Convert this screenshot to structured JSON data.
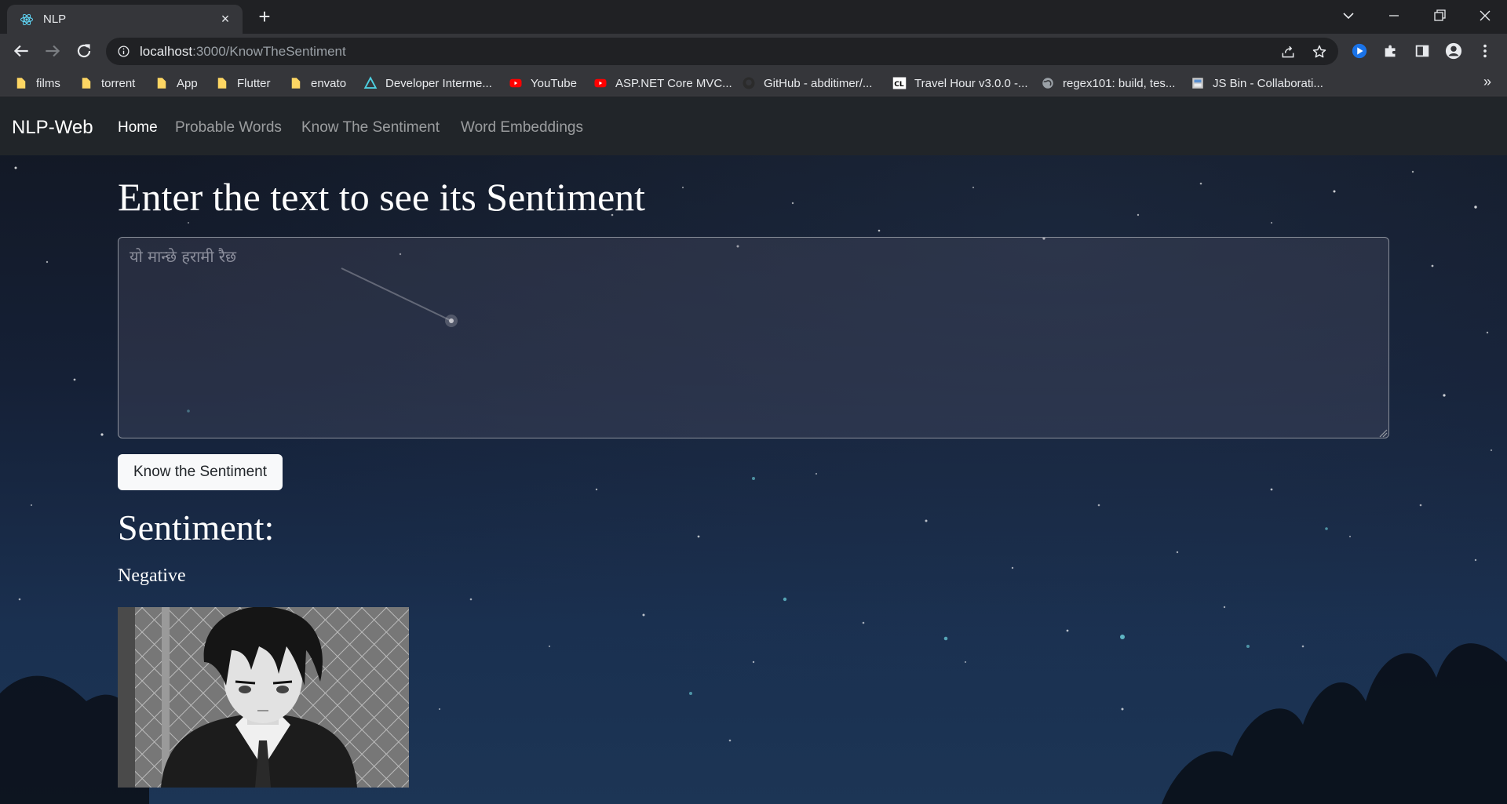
{
  "browser": {
    "tab_title": "NLP",
    "url_host": "localhost",
    "url_path": ":3000/KnowTheSentiment",
    "bookmarks": [
      {
        "label": "films",
        "icon": "folder-icon"
      },
      {
        "label": "torrent",
        "icon": "folder-icon"
      },
      {
        "label": "App",
        "icon": "folder-icon"
      },
      {
        "label": "Flutter",
        "icon": "folder-icon"
      },
      {
        "label": "envato",
        "icon": "folder-icon"
      },
      {
        "label": "Developer Interme...",
        "icon": "developer-site-icon"
      },
      {
        "label": "YouTube",
        "icon": "youtube-icon"
      },
      {
        "label": "ASP.NET Core MVC...",
        "icon": "youtube-icon"
      },
      {
        "label": "GitHub - abditimer/...",
        "icon": "github-icon"
      },
      {
        "label": "Travel Hour v3.0.0 -...",
        "icon": "codelist-icon"
      },
      {
        "label": "regex101: build, tes...",
        "icon": "globe-icon"
      },
      {
        "label": "JS Bin - Collaborati...",
        "icon": "jsbin-icon"
      }
    ],
    "bookmarks_overflow": "»"
  },
  "navbar": {
    "brand": "NLP-Web",
    "links": [
      "Home",
      "Probable Words",
      "Know The Sentiment",
      "Word Embeddings"
    ],
    "active": "Home"
  },
  "main": {
    "heading": "Enter the text to see its Sentiment",
    "textarea_placeholder": "यो मान्छे हरामी रैछ",
    "button_label": "Know the Sentiment",
    "result_title": "Sentiment:",
    "result_value": "Negative",
    "result_image": "sad-anime-character-image"
  },
  "colors": {
    "navbar_bg": "#212529",
    "button_bg": "#f8f9fa",
    "chrome_bg": "#202124",
    "toolbar_bg": "#35363a"
  }
}
